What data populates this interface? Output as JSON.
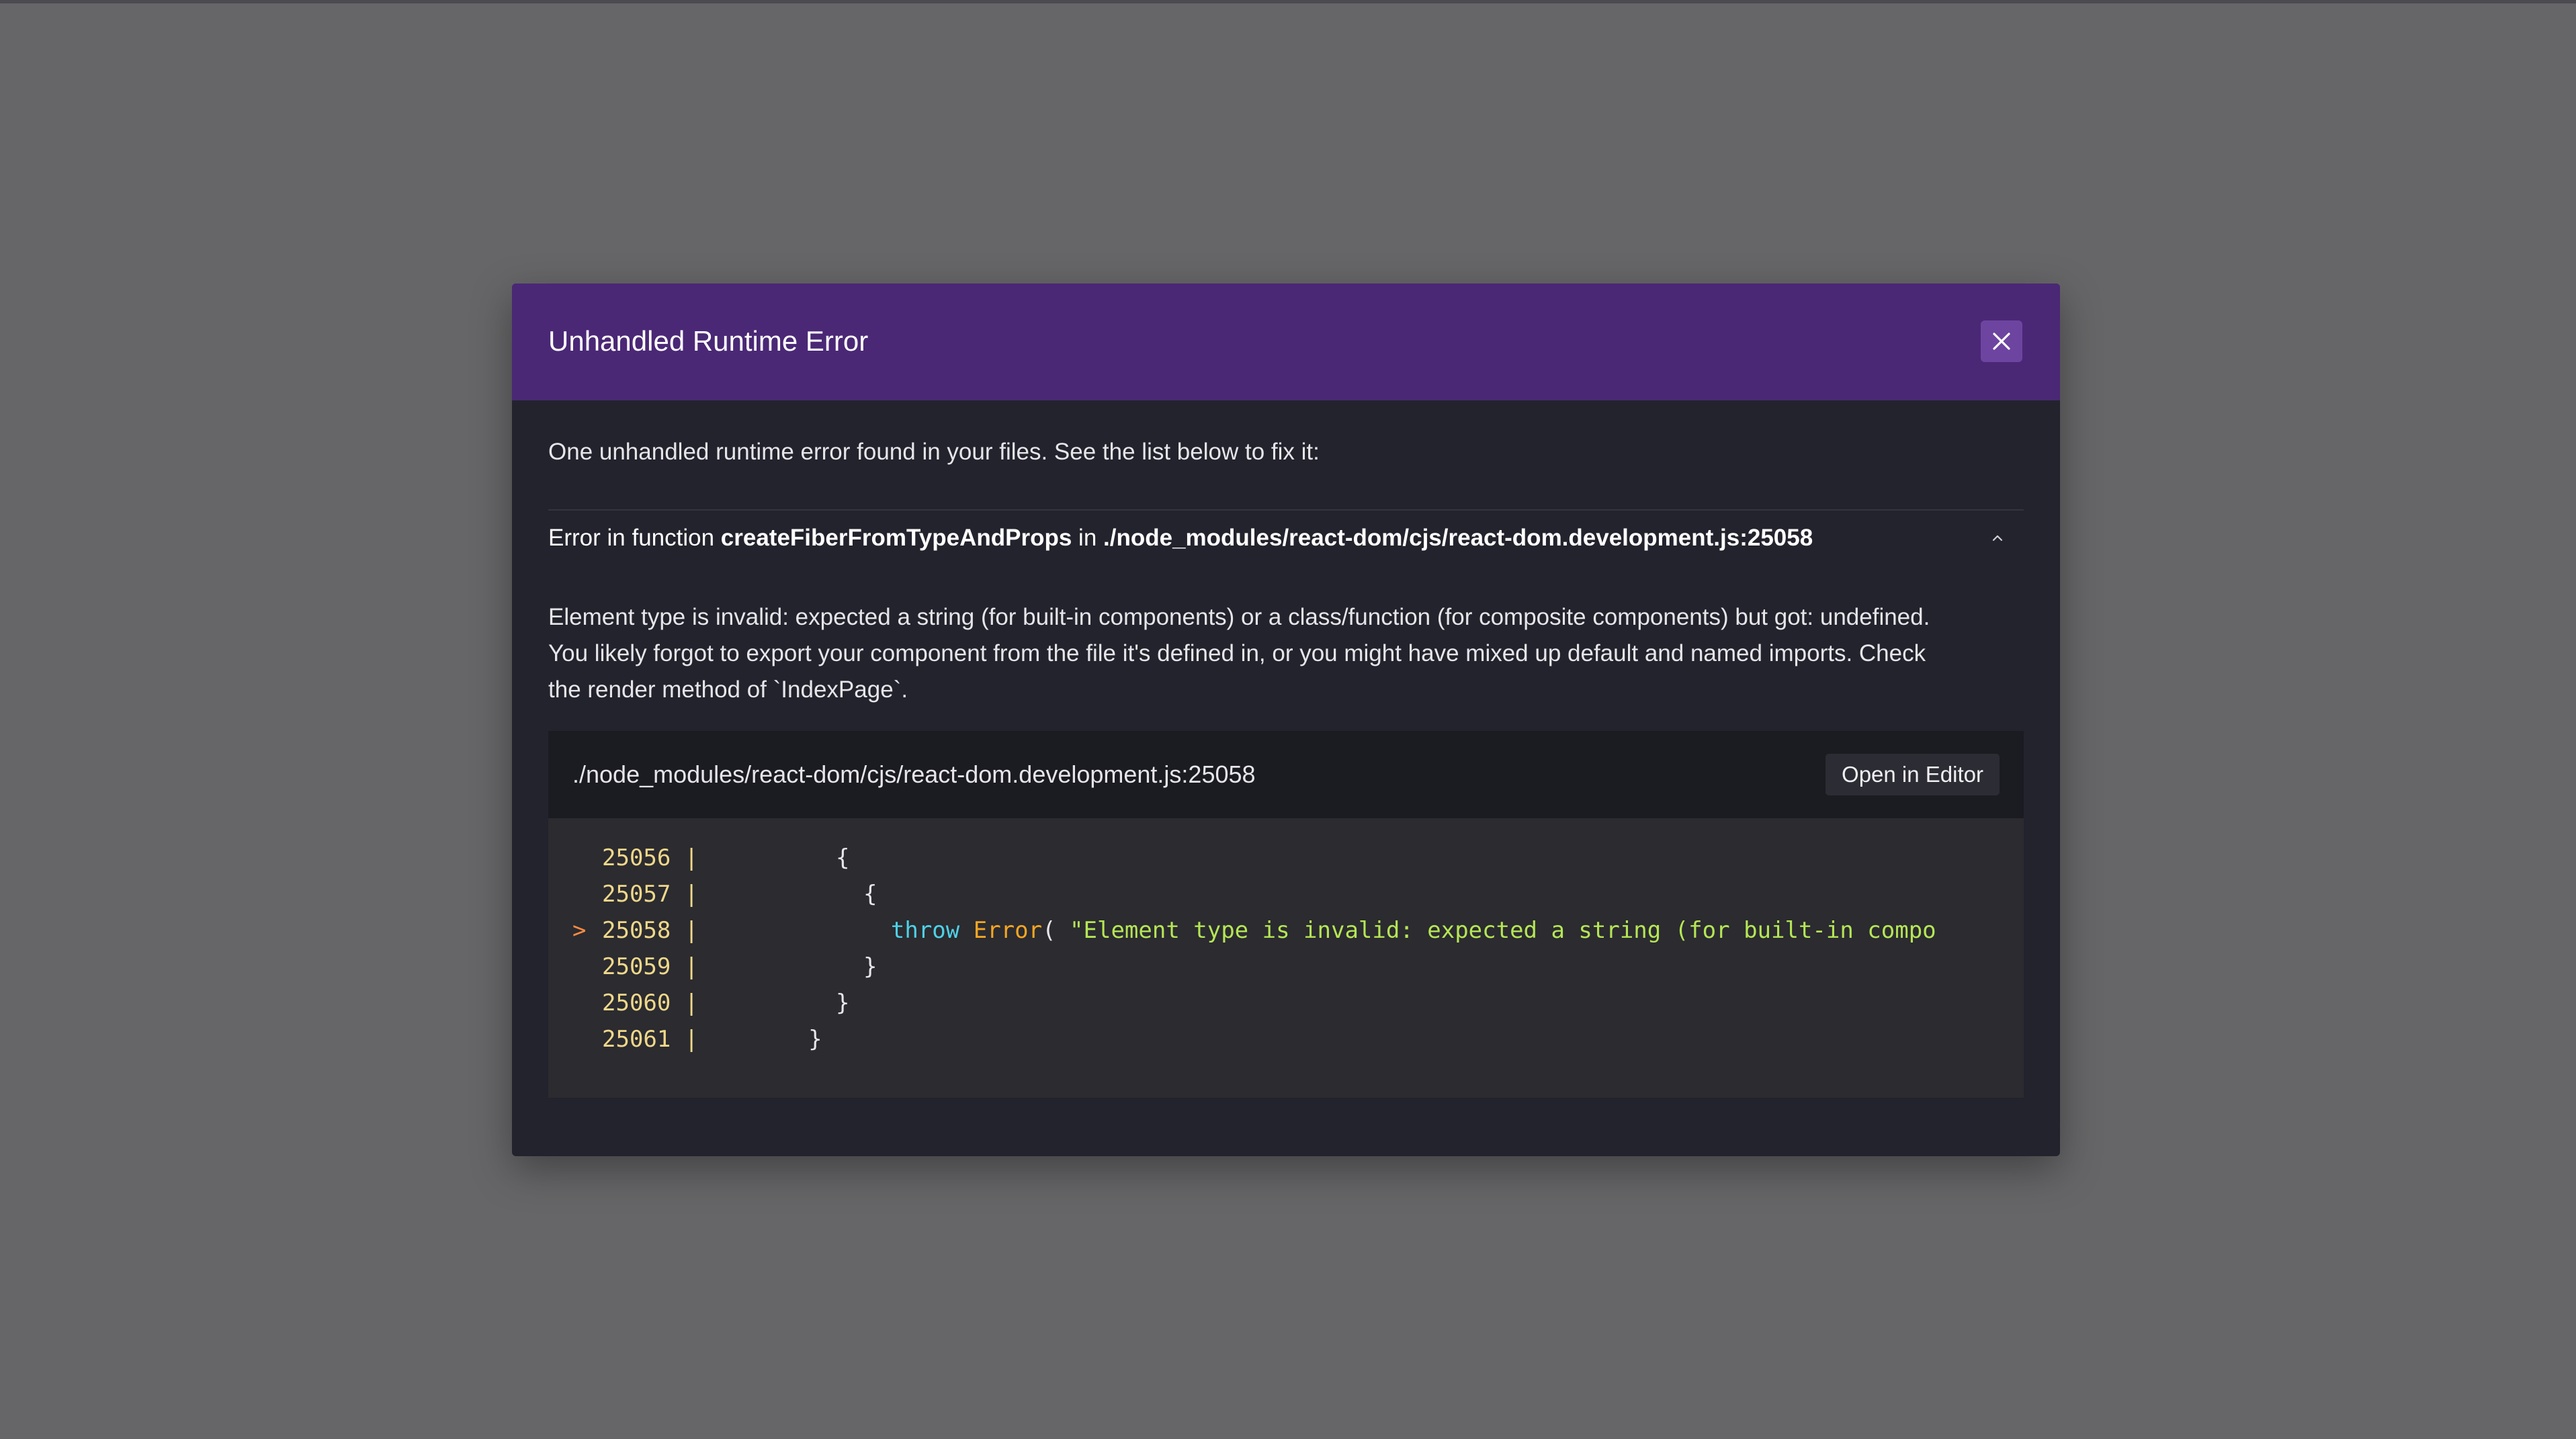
{
  "overlay": {
    "title": "Unhandled Runtime Error",
    "close_icon": "close-icon",
    "intro": "One unhandled runtime error found in your files. See the list below to fix it:",
    "error": {
      "prefix": "Error in function ",
      "function_name": "createFiberFromTypeAndProps",
      "in_word": " in ",
      "location": "./node_modules/react-dom/cjs/react-dom.development.js:25058",
      "collapse_icon": "chevron-up-icon",
      "message_lines": [
        "Element type is invalid: expected a string (for built-in components) or a class/function (for composite components) but got: undefined.",
        "You likely forgot to export your component from the file it's defined in, or you might have mixed up default and named imports. Check",
        "the render method of `IndexPage`."
      ]
    },
    "frame": {
      "file_path": "./node_modules/react-dom/cjs/react-dom.development.js:25058",
      "open_in_editor_label": "Open in Editor",
      "code_lines": [
        {
          "marker": "",
          "number": "25056",
          "code": "          {"
        },
        {
          "marker": "",
          "number": "25057",
          "code": "            {"
        },
        {
          "marker": ">",
          "number": "25058",
          "keyword": "throw",
          "func": "Error",
          "paren": "( ",
          "string": "\"Element type is invalid: expected a string (for built-in compo"
        },
        {
          "marker": "",
          "number": "25059",
          "code": "            }"
        },
        {
          "marker": "",
          "number": "25060",
          "code": "          }"
        },
        {
          "marker": "",
          "number": "25061",
          "code": "        }"
        }
      ]
    }
  },
  "colors": {
    "backdrop": "#666668",
    "header": "#4a2875",
    "modal_bg": "#23232d",
    "close_button": "#6d45a0",
    "line_marker": "#ff8c42",
    "keyword": "#4fd1e6",
    "function": "#f5a623",
    "string": "#b5e655"
  }
}
